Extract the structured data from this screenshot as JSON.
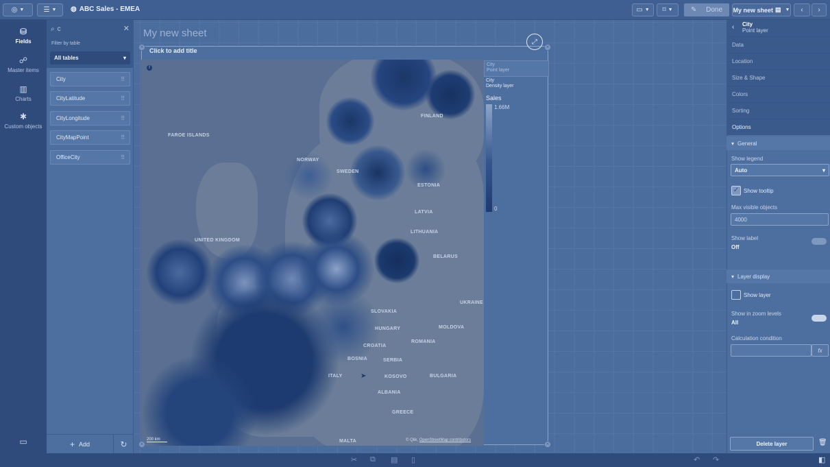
{
  "topbar": {
    "nav_icon": "compass-icon",
    "list_icon": "list-icon",
    "app_icon": "globe-icon",
    "app_title": "ABC Sales - EMEA",
    "present_icon": "presentation-icon",
    "bookmark_icon": "bookmark-icon",
    "edit_icon": "pencil-icon",
    "done_label": "Done",
    "sheet_name": "My new sheet",
    "sheets_icon": "sheets-icon",
    "prev_icon": "chevron-left-icon",
    "next_icon": "chevron-right-icon"
  },
  "leftnav": {
    "items": [
      {
        "label": "Fields",
        "icon": "database-icon"
      },
      {
        "label": "Master items",
        "icon": "link-icon"
      },
      {
        "label": "Charts",
        "icon": "chart-icon"
      },
      {
        "label": "Custom objects",
        "icon": "puzzle-icon"
      }
    ]
  },
  "assets": {
    "search_value": "c",
    "filter_label": "Filter by table",
    "table_select": "All tables",
    "fields": [
      {
        "label": "City"
      },
      {
        "label": "CityLatitude"
      },
      {
        "label": "CityLongitude"
      },
      {
        "label": "CityMapPoint"
      },
      {
        "label": "OfficeCity"
      }
    ],
    "add_label": "Add"
  },
  "sheet": {
    "title": "My new sheet",
    "chart_title": "Click to add title",
    "map_labels": [
      "FAROE ISLANDS",
      "NORWAY",
      "SWEDEN",
      "FINLAND",
      "ESTONIA",
      "LATVIA",
      "LITHUANIA",
      "UNITED KINGDOM",
      "BELARUS",
      "UKRAINE",
      "SLOVAKIA",
      "HUNGARY",
      "MOLDOVA",
      "ROMANIA",
      "SERBIA",
      "KOSOVO",
      "BULGARIA",
      "ALBANIA",
      "GREECE",
      "MALTA",
      "ITALY",
      "CROATIA",
      "BOSNIA"
    ],
    "scale": "200 km",
    "attribution_prefix": "© Qlik,",
    "attribution_link": "OpenStreetMap contributors"
  },
  "legend": {
    "point_layer_name": "City",
    "point_layer_type": "Point layer",
    "density_layer_name": "City",
    "density_layer_type": "Density layer",
    "measure": "Sales",
    "max": "1.66M",
    "min": "0"
  },
  "props": {
    "layer_name": "City",
    "layer_type": "Point layer",
    "tabs": [
      "Data",
      "Location",
      "Size & Shape",
      "Colors",
      "Sorting",
      "Options"
    ],
    "general_section": "General",
    "show_legend_label": "Show legend",
    "show_legend_value": "Auto",
    "show_tooltip_label": "Show tooltip",
    "max_visible_label": "Max visible objects",
    "max_visible_value": "4000",
    "show_label_label": "Show label",
    "show_label_value": "Off",
    "layer_display_section": "Layer display",
    "show_layer_label": "Show layer",
    "zoom_levels_label": "Show in zoom levels",
    "zoom_levels_value": "All",
    "calc_condition_label": "Calculation condition",
    "fx_label": "fx",
    "delete_label": "Delete layer"
  },
  "colors": {
    "panel": "#3a5a8c",
    "sheet": "#4d6fa0",
    "accent": "#2e4b7c",
    "density_dark": "#0f2a5c",
    "density_light": "#8fa5c7"
  }
}
